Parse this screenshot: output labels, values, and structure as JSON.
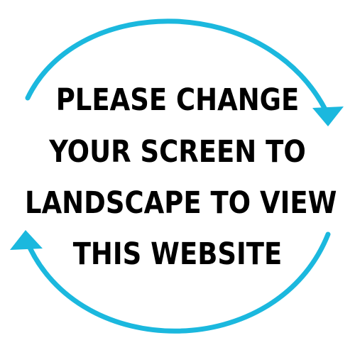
{
  "message": {
    "lines": [
      "PLEASE CHANGE",
      "YOUR SCREEN TO",
      "LANDSCAPE TO VIEW",
      "THIS WEBSITE"
    ]
  },
  "colors": {
    "arrow": "#1bb8de",
    "text": "#000000",
    "background": "#ffffff"
  },
  "icons": {
    "top_arrow": "curved-arrow-clockwise-icon",
    "bottom_arrow": "curved-arrow-return-icon"
  }
}
